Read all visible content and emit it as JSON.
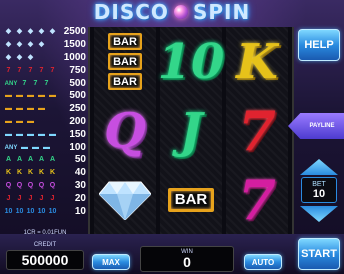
{
  "title": {
    "left": "DISCO",
    "right": "SPIN"
  },
  "paytable": [
    {
      "symbol": "diamond-x5",
      "marks": [
        "◆",
        "◆",
        "◆",
        "◆",
        "◆"
      ],
      "color": "#bfe3ff",
      "value": "2500"
    },
    {
      "symbol": "diamond-x4",
      "marks": [
        "◆",
        "◆",
        "◆",
        "◆"
      ],
      "color": "#bfe3ff",
      "value": "1500"
    },
    {
      "symbol": "diamond-x3",
      "marks": [
        "◆",
        "◆",
        "◆"
      ],
      "color": "#bfe3ff",
      "value": "1000"
    },
    {
      "symbol": "seven-mix-x5",
      "marks": [
        "7",
        "7",
        "7",
        "7",
        "7"
      ],
      "color": "#e0232f",
      "value": "750"
    },
    {
      "symbol": "seven-mix-x4",
      "marks": [
        "ANY",
        "7",
        "7",
        "7"
      ],
      "color": "#33d68a",
      "value": "500"
    },
    {
      "symbol": "bar-x5",
      "marks": [
        "▬",
        "▬",
        "▬",
        "▬",
        "▬"
      ],
      "color": "#e6a21c",
      "value": "500"
    },
    {
      "symbol": "bar-x4",
      "marks": [
        "▬",
        "▬",
        "▬",
        "▬"
      ],
      "color": "#e6a21c",
      "value": "250"
    },
    {
      "symbol": "bar-x3",
      "marks": [
        "▬",
        "▬",
        "▬"
      ],
      "color": "#e6a21c",
      "value": "200"
    },
    {
      "symbol": "any-x5",
      "marks": [
        "▬",
        "▬",
        "▬",
        "▬",
        "▬"
      ],
      "color": "#7fd8ff",
      "value": "150"
    },
    {
      "symbol": "any-x4",
      "marks": [
        "ANY",
        "▬",
        "▬",
        "▬"
      ],
      "color": "#7fd8ff",
      "value": "100"
    },
    {
      "symbol": "ten-x5",
      "marks": [
        "A",
        "A",
        "A",
        "A",
        "A"
      ],
      "color": "#33d68a",
      "value": "50"
    },
    {
      "symbol": "k-x5",
      "marks": [
        "K",
        "K",
        "K",
        "K",
        "K"
      ],
      "color": "#e6c21a",
      "value": "40"
    },
    {
      "symbol": "q-x5",
      "marks": [
        "Q",
        "Q",
        "Q",
        "Q",
        "Q"
      ],
      "color": "#c74ee0",
      "value": "30"
    },
    {
      "symbol": "j-x5",
      "marks": [
        "J",
        "J",
        "J",
        "J",
        "J"
      ],
      "color": "#e0232f",
      "value": "20"
    },
    {
      "symbol": "ten-x4",
      "marks": [
        "10",
        "10",
        "10",
        "10",
        "10"
      ],
      "color": "#2a8be0",
      "value": "10"
    }
  ],
  "reels": [
    [
      {
        "kind": "bar3",
        "label": "BAR"
      },
      {
        "kind": "glyph",
        "text": "Q",
        "color": "purple"
      },
      {
        "kind": "diamond"
      }
    ],
    [
      {
        "kind": "glyph",
        "text": "10",
        "color": "green"
      },
      {
        "kind": "glyph",
        "text": "J",
        "color": "green"
      },
      {
        "kind": "bar1",
        "label": "BAR"
      }
    ],
    [
      {
        "kind": "glyph",
        "text": "K",
        "color": "yellow"
      },
      {
        "kind": "glyph",
        "text": "7",
        "color": "red"
      },
      {
        "kind": "glyph",
        "text": "7",
        "color": "red2"
      }
    ]
  ],
  "buttons": {
    "help": "HELP",
    "start": "START",
    "max": "MAX",
    "auto": "AUTO"
  },
  "payline": {
    "label": "PAYLINE"
  },
  "bet": {
    "label": "BET",
    "value": "10"
  },
  "credit": {
    "rate": "1CR = 0.01FUN",
    "label": "CREDIT",
    "value": "500000"
  },
  "win": {
    "label": "WIN",
    "value": "0"
  }
}
